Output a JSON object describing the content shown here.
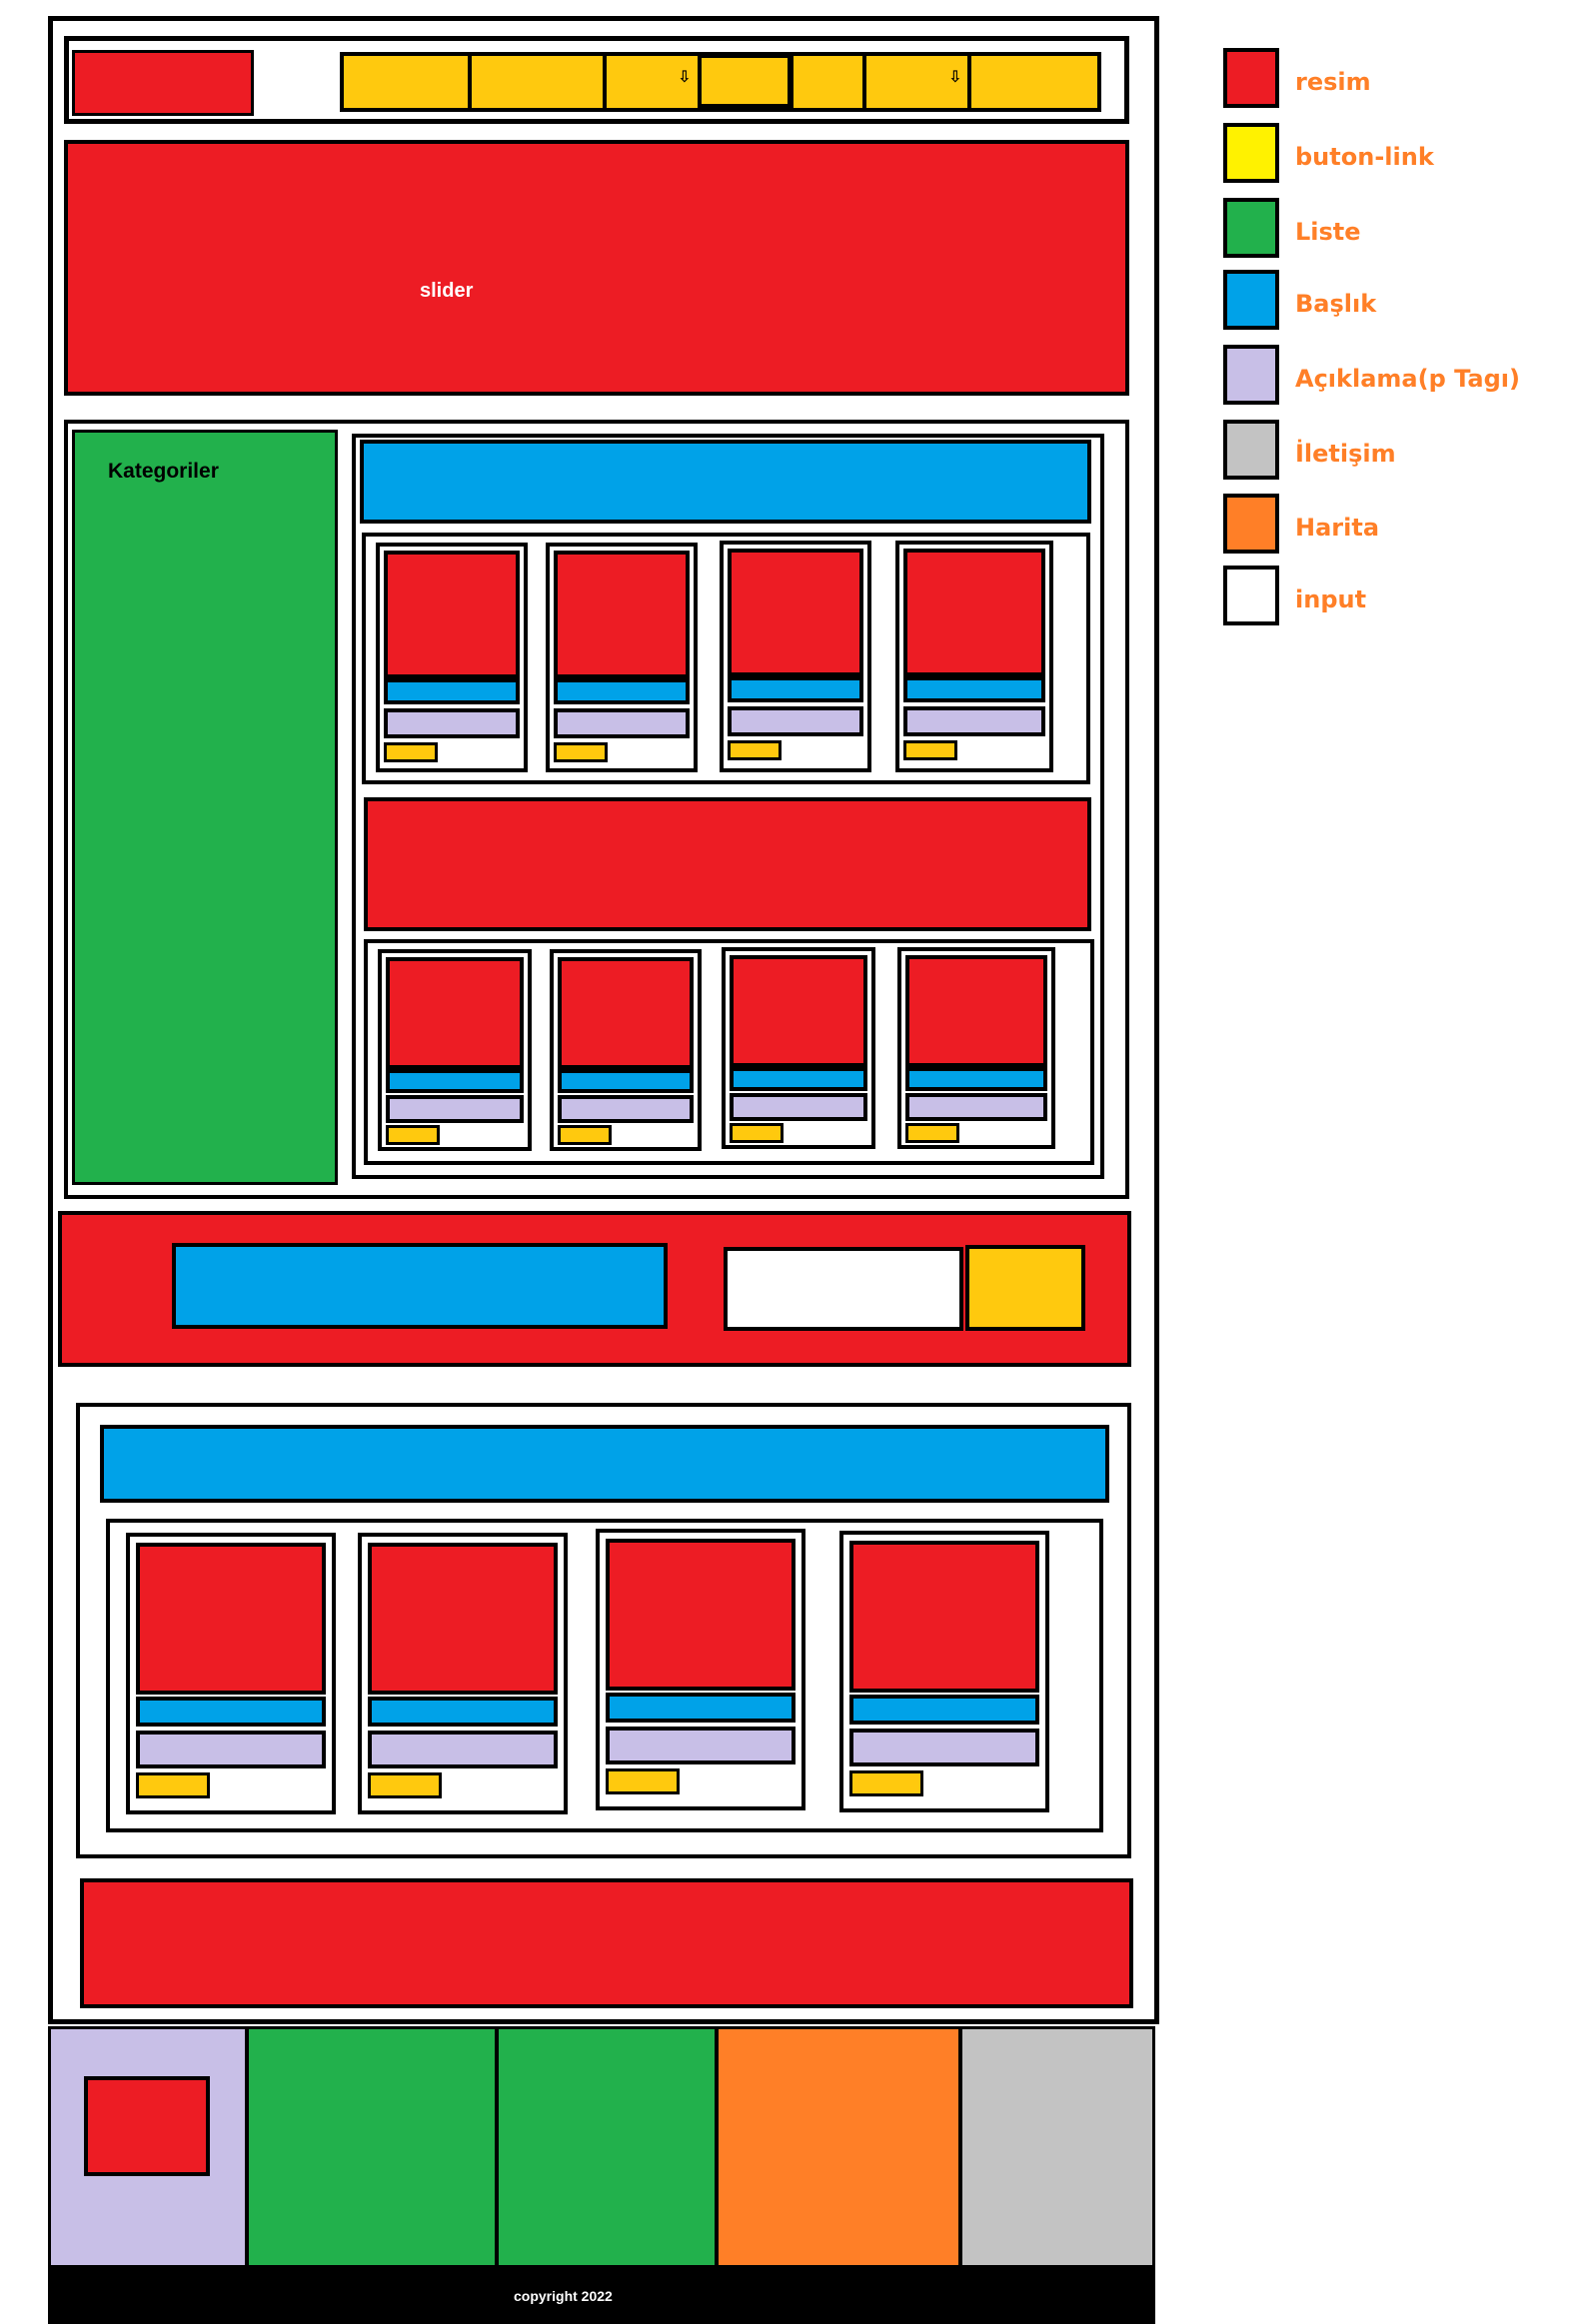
{
  "wireframe": {
    "slider_label": "slider",
    "categories_label": "Kategoriler",
    "copyright": "copyright 2022",
    "nav_dropdown_arrow": "⇩"
  },
  "legend": [
    {
      "name": "resim",
      "color": "#ed1c24"
    },
    {
      "name": "buton-link",
      "color": "#fff200"
    },
    {
      "name": "Liste",
      "color": "#22b14c"
    },
    {
      "name": "Başlık",
      "color": "#00a2e8"
    },
    {
      "name": "Açıklama(p Tagı)",
      "color": "#c8bfe7"
    },
    {
      "name": "İletişim",
      "color": "#c3c3c3"
    },
    {
      "name": "Harita",
      "color": "#ff7f27"
    },
    {
      "name": "input",
      "color": "#ffffff"
    }
  ],
  "colors": {
    "image": "#ed1c24",
    "button": "#ffc90e",
    "list": "#22b14c",
    "heading": "#00a2e8",
    "paragraph": "#c8bfe7",
    "contact": "#c3c3c3",
    "map": "#ff7f27",
    "input": "#ffffff"
  }
}
